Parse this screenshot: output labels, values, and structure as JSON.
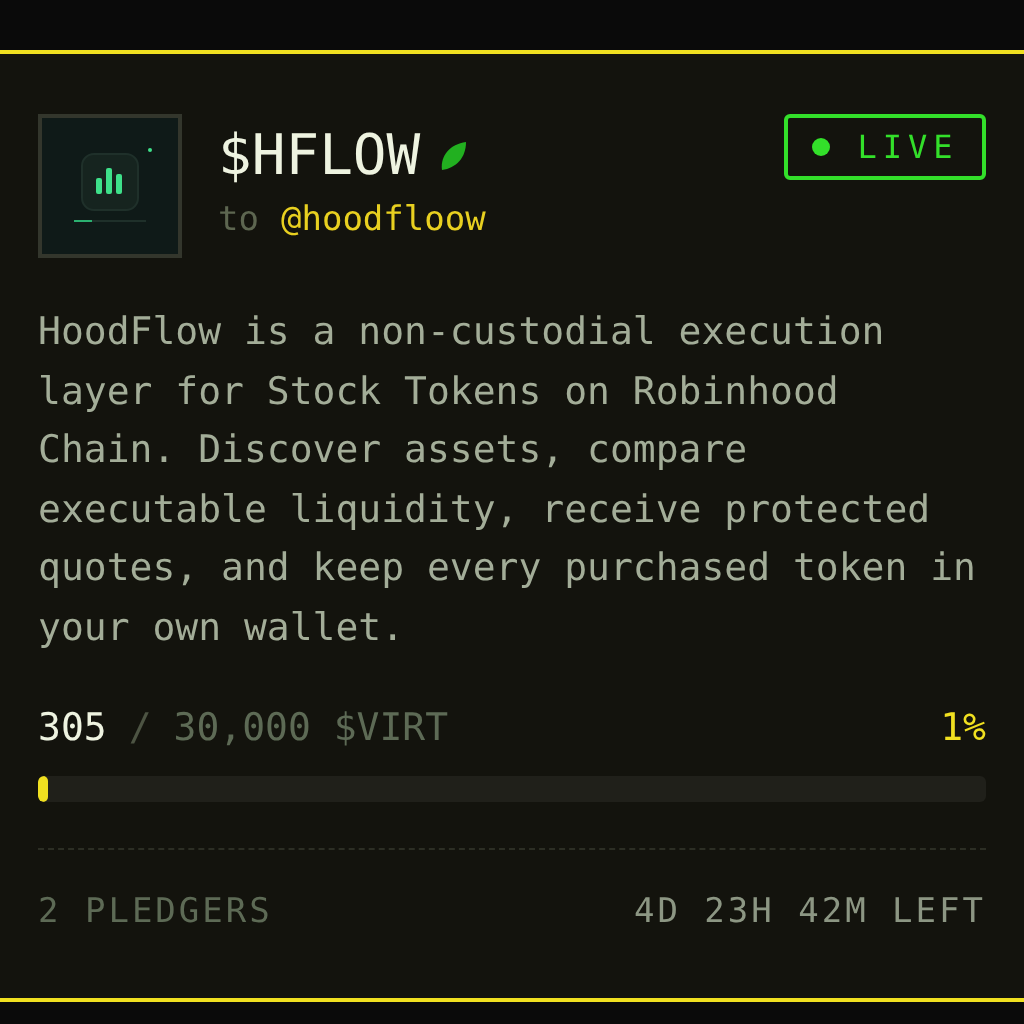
{
  "token": {
    "ticker": "$HFLOW",
    "to_label": "to",
    "handle": "@hoodfloow"
  },
  "status": {
    "label": "LIVE",
    "live": true
  },
  "description": "HoodFlow is a non-custodial execution layer for Stock Tokens on Robinhood Chain. Discover assets, compare executable liquidity, receive protected quotes, and keep every purchased token in your own wallet.",
  "progress": {
    "raised": "305",
    "separator": "/",
    "goal": "30,000 $VIRT",
    "percent": "1%",
    "level": 0.01
  },
  "footer": {
    "pledgers": "2 PLEDGERS",
    "time_left": "4D 23H 42M LEFT"
  }
}
